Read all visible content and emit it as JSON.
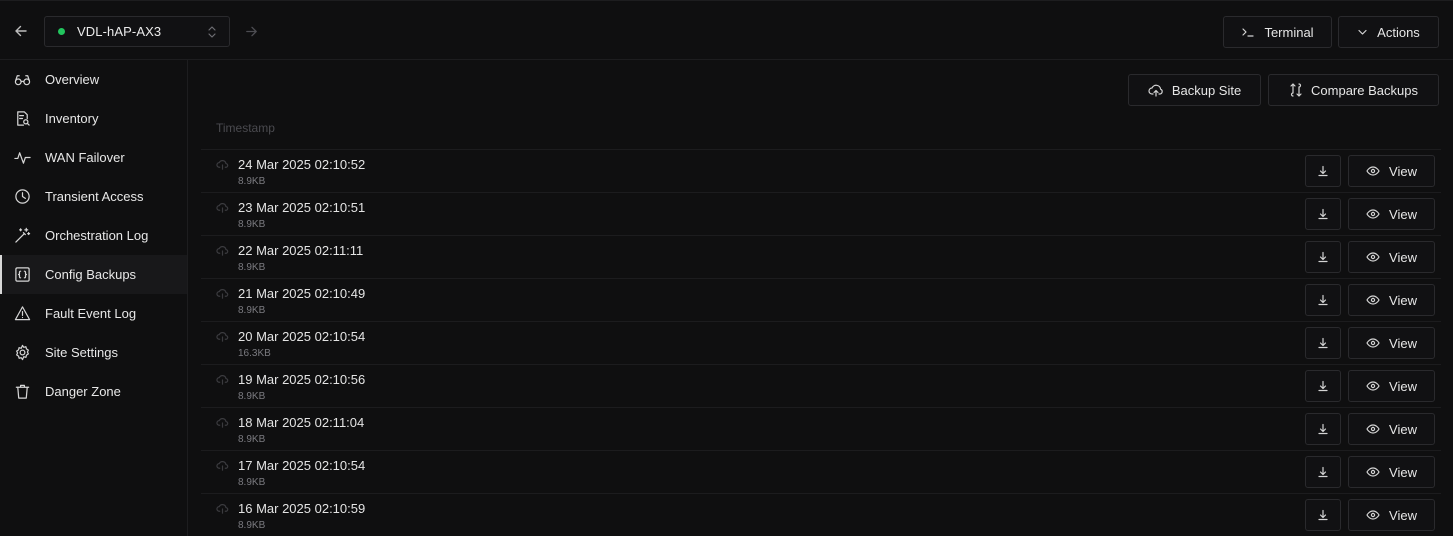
{
  "header": {
    "site_name": "VDL-hAP-AX3",
    "site_status_color": "#22c55e",
    "terminal_label": "Terminal",
    "actions_label": "Actions"
  },
  "sidebar": {
    "active": "Config Backups",
    "items": [
      {
        "label": "Overview",
        "icon": "glasses-icon"
      },
      {
        "label": "Inventory",
        "icon": "file-search-icon"
      },
      {
        "label": "WAN Failover",
        "icon": "activity-icon"
      },
      {
        "label": "Transient Access",
        "icon": "clock-icon"
      },
      {
        "label": "Orchestration Log",
        "icon": "wand-icon"
      },
      {
        "label": "Config Backups",
        "icon": "braces-file-icon"
      },
      {
        "label": "Fault Event Log",
        "icon": "warning-icon"
      },
      {
        "label": "Site Settings",
        "icon": "gear-icon"
      },
      {
        "label": "Danger Zone",
        "icon": "trash-icon"
      }
    ]
  },
  "main": {
    "backup_site_label": "Backup Site",
    "compare_backups_label": "Compare Backups",
    "column_header": "Timestamp",
    "view_label": "View",
    "backups": [
      {
        "timestamp": "24 Mar 2025 02:10:52",
        "size": "8.9KB"
      },
      {
        "timestamp": "23 Mar 2025 02:10:51",
        "size": "8.9KB"
      },
      {
        "timestamp": "22 Mar 2025 02:11:11",
        "size": "8.9KB"
      },
      {
        "timestamp": "21 Mar 2025 02:10:49",
        "size": "8.9KB"
      },
      {
        "timestamp": "20 Mar 2025 02:10:54",
        "size": "16.3KB"
      },
      {
        "timestamp": "19 Mar 2025 02:10:56",
        "size": "8.9KB"
      },
      {
        "timestamp": "18 Mar 2025 02:11:04",
        "size": "8.9KB"
      },
      {
        "timestamp": "17 Mar 2025 02:10:54",
        "size": "8.9KB"
      },
      {
        "timestamp": "16 Mar 2025 02:10:59",
        "size": "8.9KB"
      }
    ]
  }
}
